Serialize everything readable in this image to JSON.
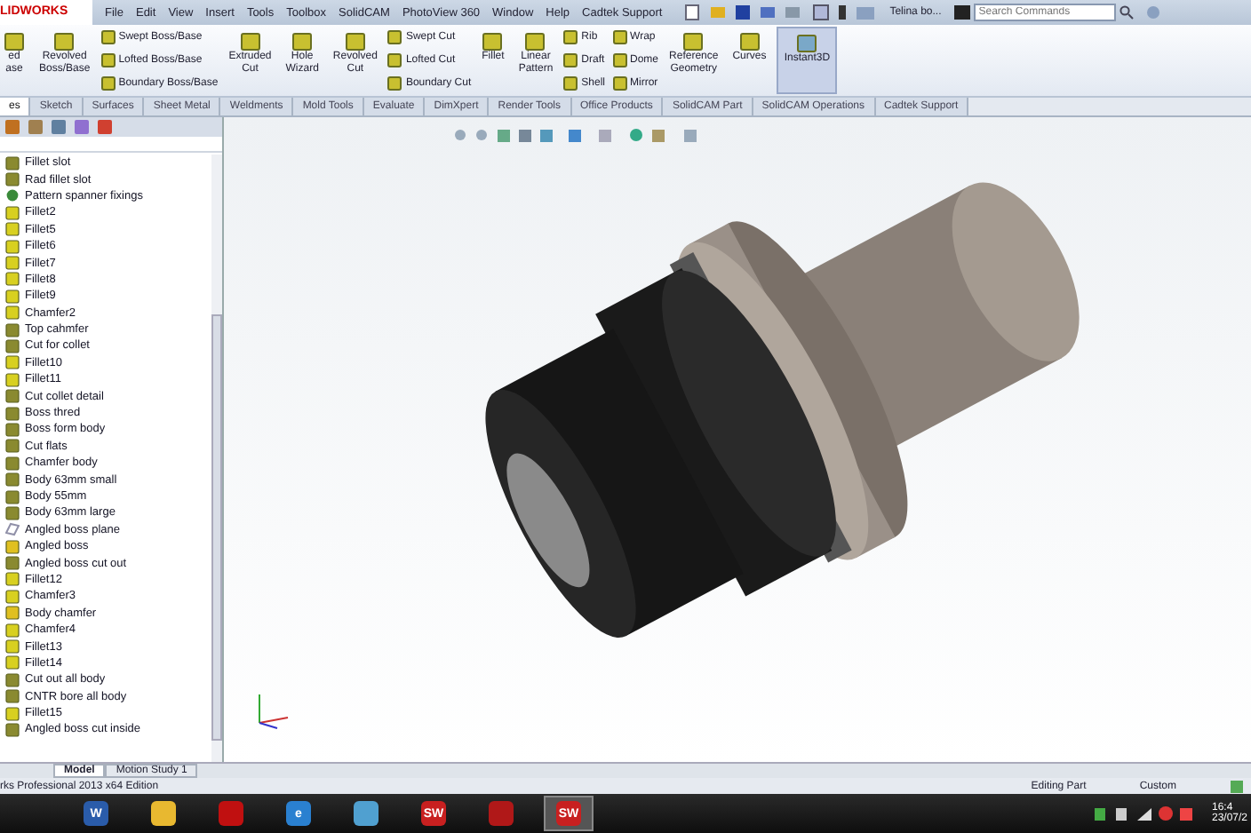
{
  "title_bar": {
    "logo": "LIDWORKS",
    "menu": [
      "File",
      "Edit",
      "View",
      "Insert",
      "Tools",
      "Toolbox",
      "SolidCAM",
      "PhotoView 360",
      "Window",
      "Help",
      "Cadtek Support"
    ],
    "document": "Telina bo...",
    "search": {
      "placeholder": "Search Commands"
    }
  },
  "ribbon": [
    {
      "kind": "big",
      "lines": [
        "ed",
        "ase"
      ]
    },
    {
      "kind": "big",
      "lines": [
        "Revolved",
        "Boss/Base"
      ]
    },
    {
      "kind": "stack",
      "items": [
        "Swept Boss/Base",
        "Lofted Boss/Base",
        "Boundary Boss/Base"
      ]
    },
    {
      "kind": "big",
      "lines": [
        "Extruded",
        "Cut"
      ]
    },
    {
      "kind": "big",
      "lines": [
        "Hole",
        "Wizard"
      ]
    },
    {
      "kind": "big",
      "lines": [
        "Revolved",
        "Cut"
      ]
    },
    {
      "kind": "stack",
      "items": [
        "Swept Cut",
        "Lofted Cut",
        "Boundary Cut"
      ]
    },
    {
      "kind": "big",
      "lines": [
        "Fillet"
      ]
    },
    {
      "kind": "big",
      "lines": [
        "Linear",
        "Pattern"
      ]
    },
    {
      "kind": "stack",
      "items": [
        "Rib",
        "Draft",
        "Shell"
      ]
    },
    {
      "kind": "stack",
      "items": [
        "Wrap",
        "Dome",
        "Mirror"
      ]
    },
    {
      "kind": "big",
      "lines": [
        "Reference",
        "Geometry"
      ]
    },
    {
      "kind": "big",
      "lines": [
        "Curves"
      ]
    },
    {
      "kind": "toggle",
      "lines": [
        "Instant3D"
      ],
      "selected": true
    }
  ],
  "tabs": [
    {
      "label": "es",
      "selected": true
    },
    {
      "label": "Sketch",
      "selected": false
    },
    {
      "label": "Surfaces",
      "selected": false
    },
    {
      "label": "Sheet Metal",
      "selected": false
    },
    {
      "label": "Weldments",
      "selected": false
    },
    {
      "label": "Mold Tools",
      "selected": false
    },
    {
      "label": "Evaluate",
      "selected": false
    },
    {
      "label": "DimXpert",
      "selected": false
    },
    {
      "label": "Render Tools",
      "selected": false
    },
    {
      "label": "Office Products",
      "selected": false
    },
    {
      "label": "SolidCAM Part",
      "selected": false
    },
    {
      "label": "SolidCAM Operations",
      "selected": false
    },
    {
      "label": "Cadtek Support",
      "selected": false
    }
  ],
  "tree": [
    {
      "kind": "cut",
      "label": "Fillet slot"
    },
    {
      "kind": "cut",
      "label": "Rad fillet slot"
    },
    {
      "kind": "pattern",
      "label": "Pattern spanner fixings"
    },
    {
      "kind": "fillet",
      "label": "Fillet2"
    },
    {
      "kind": "fillet",
      "label": "Fillet5"
    },
    {
      "kind": "fillet",
      "label": "Fillet6"
    },
    {
      "kind": "fillet",
      "label": "Fillet7"
    },
    {
      "kind": "fillet",
      "label": "Fillet8"
    },
    {
      "kind": "fillet",
      "label": "Fillet9"
    },
    {
      "kind": "fillet",
      "label": "Chamfer2"
    },
    {
      "kind": "cut",
      "label": "Top cahmfer"
    },
    {
      "kind": "cut",
      "label": "Cut for collet"
    },
    {
      "kind": "fillet",
      "label": "Fillet10"
    },
    {
      "kind": "fillet",
      "label": "Fillet11"
    },
    {
      "kind": "cut",
      "label": "Cut collet detail"
    },
    {
      "kind": "cut",
      "label": "Boss thred"
    },
    {
      "kind": "cut",
      "label": "Boss form body"
    },
    {
      "kind": "cut",
      "label": "Cut flats"
    },
    {
      "kind": "cut",
      "label": "Chamfer body"
    },
    {
      "kind": "cut",
      "label": "Body 63mm small"
    },
    {
      "kind": "cut",
      "label": "Body 55mm"
    },
    {
      "kind": "cut",
      "label": "Body 63mm large"
    },
    {
      "kind": "plane",
      "label": "Angled boss plane"
    },
    {
      "kind": "boss",
      "label": "Angled boss"
    },
    {
      "kind": "cut",
      "label": "Angled boss cut out"
    },
    {
      "kind": "fillet",
      "label": "Fillet12"
    },
    {
      "kind": "fillet",
      "label": "Chamfer3"
    },
    {
      "kind": "boss",
      "label": "Body chamfer"
    },
    {
      "kind": "fillet",
      "label": "Chamfer4"
    },
    {
      "kind": "fillet",
      "label": "Fillet13"
    },
    {
      "kind": "fillet",
      "label": "Fillet14"
    },
    {
      "kind": "cut",
      "label": "Cut out all body"
    },
    {
      "kind": "cut",
      "label": "CNTR bore all body"
    },
    {
      "kind": "fillet",
      "label": "Fillet15"
    },
    {
      "kind": "cut",
      "label": "Angled boss cut inside"
    }
  ],
  "model_tabs": [
    {
      "label": "Model",
      "selected": true
    },
    {
      "label": "Motion Study 1",
      "selected": false
    }
  ],
  "status_bar": {
    "product": "rks Professional 2013 x64 Edition",
    "mode": "Editing Part",
    "units": "Custom"
  },
  "taskbar": {
    "apps": [
      {
        "kind": "word",
        "label": "W",
        "selected": false
      },
      {
        "kind": "folder",
        "selected": false
      },
      {
        "kind": "media",
        "selected": false
      },
      {
        "kind": "browser",
        "label": "e",
        "selected": false
      },
      {
        "kind": "feather",
        "selected": false
      },
      {
        "kind": "solidworks",
        "label": "SW",
        "selected": false
      },
      {
        "kind": "lips",
        "selected": false
      },
      {
        "kind": "solidworks",
        "label": "SW",
        "selected": true
      }
    ],
    "time": "16:4",
    "date": "23/07/2"
  }
}
